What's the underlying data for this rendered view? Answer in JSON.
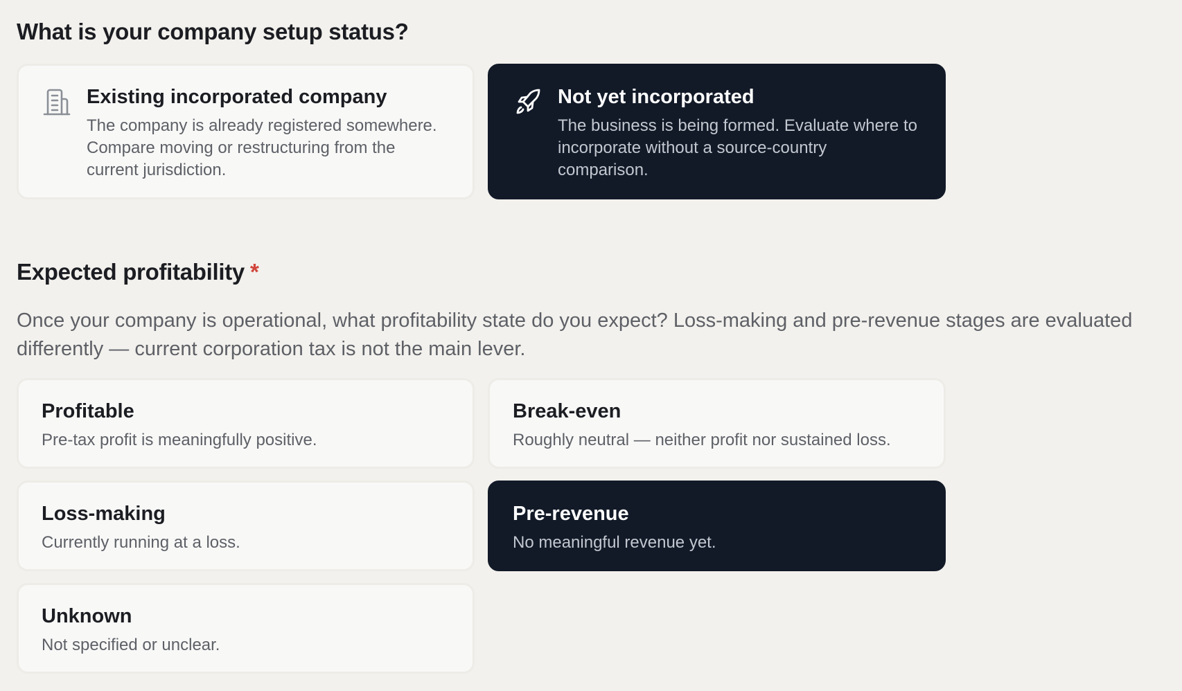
{
  "setup": {
    "question": "What is your company setup status?",
    "options": [
      {
        "title": "Existing incorporated company",
        "description": "The company is already registered somewhere. Compare moving or restructuring from the current jurisdiction.",
        "icon": "building-icon",
        "selected": false
      },
      {
        "title": "Not yet incorporated",
        "description": "The business is being formed. Evaluate where to incorporate without a source-country comparison.",
        "icon": "rocket-icon",
        "selected": true
      }
    ]
  },
  "profitability": {
    "question": "Expected profitability",
    "required_marker": "*",
    "description": "Once your company is operational, what profitability state do you expect? Loss-making and pre-revenue stages are evaluated differently — current corporation tax is not the main lever.",
    "options": [
      {
        "title": "Profitable",
        "description": "Pre-tax profit is meaningfully positive.",
        "selected": false
      },
      {
        "title": "Break-even",
        "description": "Roughly neutral — neither profit nor sustained loss.",
        "selected": false
      },
      {
        "title": "Loss-making",
        "description": "Currently running at a loss.",
        "selected": false
      },
      {
        "title": "Pre-revenue",
        "description": "No meaningful revenue yet.",
        "selected": true
      },
      {
        "title": "Unknown",
        "description": "Not specified or unclear.",
        "selected": false
      }
    ]
  },
  "colors": {
    "background": "#f3f1ed",
    "card": "#f8f8f7",
    "selected_card": "#121a28",
    "required": "#d1453b"
  }
}
